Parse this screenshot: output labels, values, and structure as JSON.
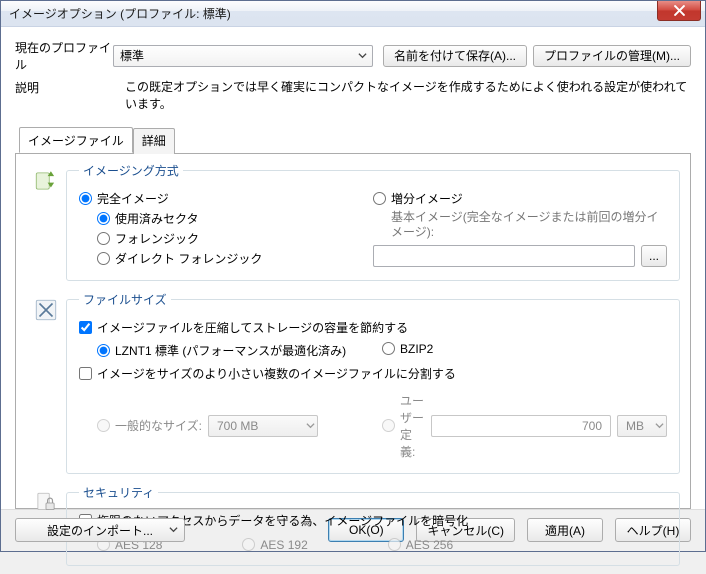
{
  "window": {
    "title": "イメージオプション (プロファイル: 標準)"
  },
  "profile": {
    "label": "現在のプロファイル",
    "selected": "標準",
    "save_as": "名前を付けて保存(A)...",
    "manage": "プロファイルの管理(M)..."
  },
  "description": {
    "label": "説明",
    "text": "この既定オプションでは早く確実にコンパクトなイメージを作成するためによく使われる設定が使われています。"
  },
  "tabs": {
    "image_file": "イメージファイル",
    "advanced": "詳細"
  },
  "imaging": {
    "legend": "イメージング方式",
    "full": "完全イメージ",
    "used": "使用済みセクタ",
    "forensic": "フォレンジック",
    "direct_forensic": "ダイレクト フォレンジック",
    "incremental": "増分イメージ",
    "base_hint": "基本イメージ(完全なイメージまたは前回の増分イメージ):",
    "browse": "..."
  },
  "filesize": {
    "legend": "ファイルサイズ",
    "compress": "イメージファイルを圧縮してストレージの容量を節約する",
    "lznt1": "LZNT1 標準 (パフォーマンスが最適化済み)",
    "bzip2": "BZIP2",
    "split": "イメージをサイズのより小さい複数のイメージファイルに分割する",
    "general_size": "一般的なサイズ:",
    "general_value": "700 MB",
    "user_defined": "ユーザー定義:",
    "user_value": "700",
    "user_unit": "MB"
  },
  "security": {
    "legend": "セキュリティ",
    "encrypt": "権限のないアクセスからデータを守る為、イメージファイルを暗号化",
    "aes128": "AES 128",
    "aes192": "AES 192",
    "aes256": "AES 256"
  },
  "footer": {
    "import": "設定のインポート...",
    "ok": "OK(O)",
    "cancel": "キャンセル(C)",
    "apply": "適用(A)",
    "help": "ヘルプ(H)"
  }
}
